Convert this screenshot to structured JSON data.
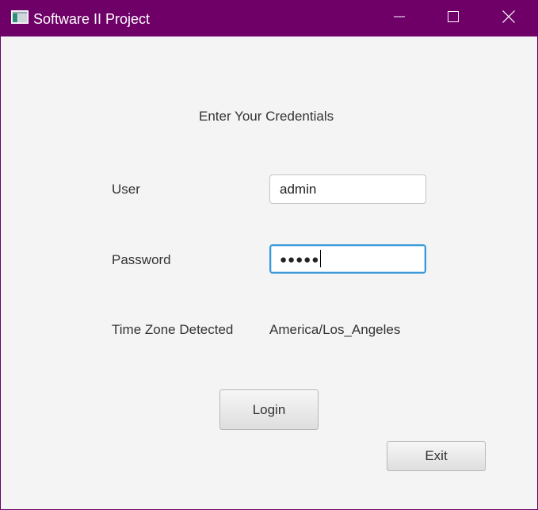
{
  "window": {
    "title": "Software II Project",
    "title_bar_color": "#6f0068"
  },
  "form": {
    "heading": "Enter Your Credentials",
    "user_label": "User",
    "user_value": "admin",
    "password_label": "Password",
    "password_masked": "●●●●●",
    "timezone_label": "Time Zone Detected",
    "timezone_value": "America/Los_Angeles"
  },
  "buttons": {
    "login": "Login",
    "exit": "Exit"
  },
  "icons": {
    "app": "app-window-icon",
    "minimize": "minimize-icon",
    "maximize": "maximize-icon",
    "close": "close-icon"
  },
  "colors": {
    "focus_border": "#3b9ad9",
    "background": "#f4f4f4"
  }
}
